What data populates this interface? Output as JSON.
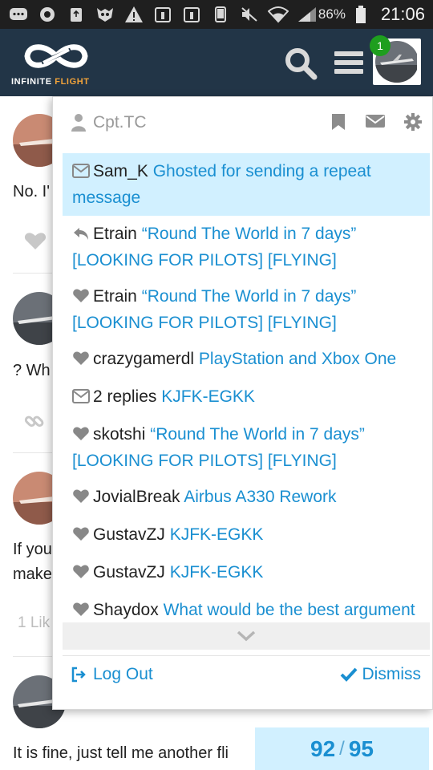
{
  "status_bar": {
    "battery_percent": "86%",
    "time": "21:06",
    "icons": [
      "chat-icon",
      "settings-icon",
      "recycle-icon",
      "owl-icon",
      "warning-icon",
      "calendar-icon",
      "calendar-icon",
      "phone-icon",
      "mute-icon",
      "wifi-icon",
      "signal-icon",
      "battery-icon"
    ]
  },
  "header": {
    "logo_text_main": "INFINITE",
    "logo_text_accent": "FLIGHT",
    "notification_badge": "1"
  },
  "topic": {
    "posts": [
      {
        "text": "No. I'",
        "action_icon": "heart-icon"
      },
      {
        "text": "? Wh",
        "action_icon": "link-icon"
      },
      {
        "text_line1": "If you",
        "text_line2": "make",
        "likes": "1 Lik"
      },
      {
        "text": "It is fine, just tell me another fli"
      }
    ],
    "progress": {
      "current": "92",
      "total": "95"
    }
  },
  "panel": {
    "username": "Cpt.TC",
    "notifications": [
      {
        "icon": "envelope-icon",
        "user": "Sam_K",
        "link": "Ghosted for sending a repeat message",
        "highlight": true
      },
      {
        "icon": "reply-icon",
        "user": "Etrain",
        "link": "“Round The World in 7 days” [LOOKING FOR PILOTS] [FLYING]",
        "highlight": false
      },
      {
        "icon": "heart-icon",
        "user": "Etrain",
        "link": "“Round The World in 7 days” [LOOKING FOR PILOTS] [FLYING]",
        "highlight": false
      },
      {
        "icon": "heart-icon",
        "user": "crazygamerdl",
        "link": "PlayStation and Xbox One",
        "highlight": false
      },
      {
        "icon": "envelope-icon",
        "user": "2 replies",
        "link": "KJFK-EGKK",
        "highlight": false
      },
      {
        "icon": "heart-icon",
        "user": "skotshi",
        "link": "“Round The World in 7 days” [LOOKING FOR PILOTS] [FLYING]",
        "highlight": false
      },
      {
        "icon": "heart-icon",
        "user": "JovialBreak",
        "link": "Airbus A330 Rework",
        "highlight": false
      },
      {
        "icon": "heart-icon",
        "user": "GustavZJ",
        "link": "KJFK-EGKK",
        "highlight": false
      },
      {
        "icon": "heart-icon",
        "user": "GustavZJ",
        "link": "KJFK-EGKK",
        "highlight": false
      },
      {
        "icon": "heart-icon",
        "user": "Shaydox",
        "link": "What would be the best argument to convince people to buy IF",
        "highlight": false
      }
    ],
    "logout_label": "Log Out",
    "dismiss_label": "Dismiss"
  },
  "colors": {
    "header_bg": "#223547",
    "link": "#1a8fd1",
    "highlight_bg": "#d1f0ff",
    "badge": "#1e9e1e",
    "logo_accent": "#f2a33a"
  }
}
